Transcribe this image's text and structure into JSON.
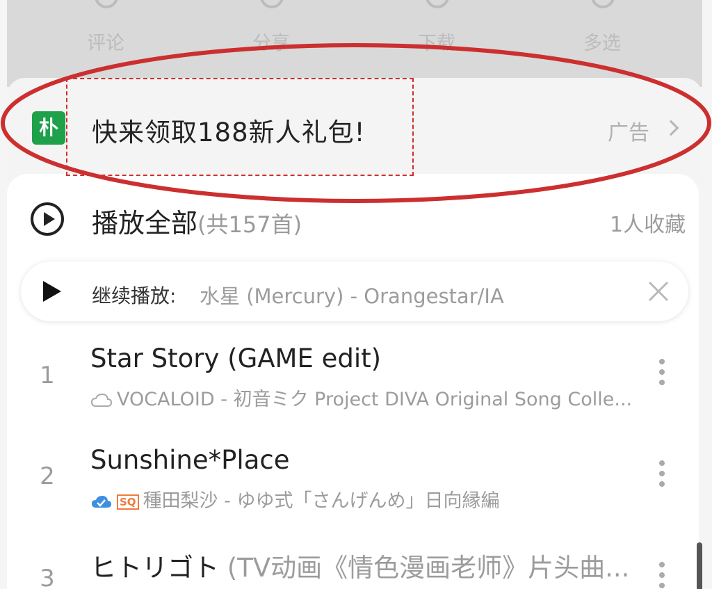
{
  "action_bar": {
    "items": [
      {
        "label": "评论",
        "icon": "comment-icon"
      },
      {
        "label": "分享",
        "icon": "share-icon"
      },
      {
        "label": "下载",
        "icon": "download-icon"
      },
      {
        "label": "多选",
        "icon": "multiselect-icon"
      }
    ]
  },
  "ad": {
    "logo_text": "朴",
    "text": "快来领取188新人礼包!",
    "tag": "广告",
    "icon": "chevron-right-icon"
  },
  "playlist": {
    "play_all_label": "播放全部",
    "count_label": "(共157首)",
    "favorites": "1人收藏",
    "resume_label": "继续播放:",
    "resume_track": "水星 (Mercury) - Orangestar/IA",
    "songs": [
      {
        "index": "1",
        "title": "Star Story (GAME edit)",
        "title_suffix": "",
        "subtitle": "VOCALOID - 初音ミク Project DIVA Original Song Colle...",
        "badge": ""
      },
      {
        "index": "2",
        "title": "Sunshine*Place",
        "title_suffix": "",
        "subtitle": "種田梨沙 - ゆゆ式「さんげんめ」日向縁編",
        "badge": "SQ"
      },
      {
        "index": "3",
        "title": "ヒトリゴト",
        "title_suffix": " (TV动画《情色漫画老师》片头曲...",
        "subtitle": "",
        "badge": ""
      }
    ]
  },
  "colors": {
    "ad_logo": "#1fa04a",
    "annotation_red": "#cc2f2f",
    "sq_badge": "#f07a3c",
    "cloud_check": "#3d8fe0"
  }
}
